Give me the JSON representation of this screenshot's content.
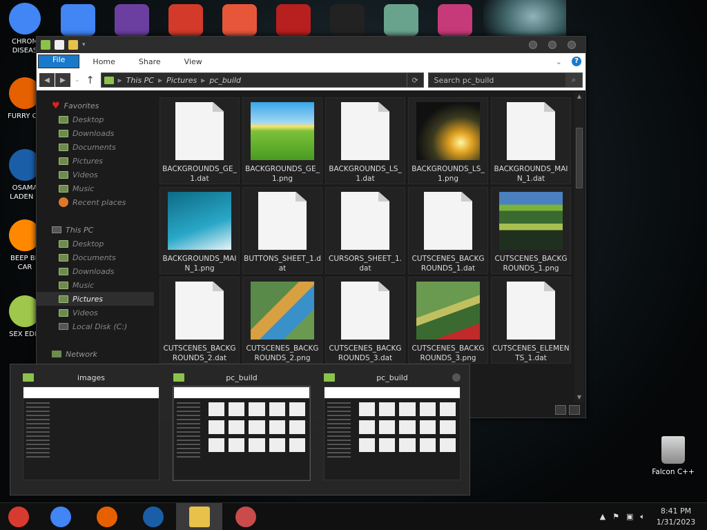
{
  "desktop": {
    "left_icons": [
      {
        "label": "CHROM DISEAS",
        "icon": "chrome-icon",
        "color": "#4285f4"
      },
      {
        "label": "FURRY CU",
        "icon": "firefox-icon",
        "color": "#e66000"
      },
      {
        "label": "OSAMA LADEN E",
        "icon": "obama-logo-icon",
        "color": "#1a5ea8"
      },
      {
        "label": "BEEP BE CAR",
        "icon": "vlc-icon",
        "color": "#ff8800"
      },
      {
        "label": "SEX EDIT",
        "icon": "hex-editor-icon",
        "color": "#9fc74b"
      }
    ],
    "top_icons": [
      {
        "icon": "chrome-icon",
        "color": "#4285f4"
      },
      {
        "icon": "visual-studio-icon",
        "color": "#6b3fa0"
      },
      {
        "icon": "number-2-icon",
        "color": "#d43a2a"
      },
      {
        "icon": "p-badge-icon",
        "color": "#e8563a"
      },
      {
        "icon": "red-logo-icon",
        "color": "#b81f1f"
      },
      {
        "icon": "terminal-icon",
        "color": "#222222"
      },
      {
        "icon": "character-icon",
        "color": "#6aa38d"
      },
      {
        "icon": "film-icon",
        "color": "#c73a7a"
      }
    ],
    "recycle_label": "Falcon C++"
  },
  "explorer": {
    "ribbon_tabs": [
      "File",
      "Home",
      "Share",
      "View"
    ],
    "address": [
      "This PC",
      "Pictures",
      "pc_build"
    ],
    "search_placeholder": "Search pc_build",
    "favorites_header": "Favorites",
    "favorites": [
      "Desktop",
      "Downloads",
      "Documents",
      "Pictures",
      "Videos",
      "Music",
      "Recent places"
    ],
    "thispc_header": "This PC",
    "thispc": [
      "Desktop",
      "Documents",
      "Downloads",
      "Music",
      "Pictures",
      "Videos",
      "Local Disk (C:)"
    ],
    "network_header": "Network",
    "selected_nav": "Pictures",
    "files": [
      {
        "name": "BACKGROUNDS_GE_1.dat",
        "kind": "dat"
      },
      {
        "name": "BACKGROUNDS_GE_1.png",
        "kind": "png",
        "art": "green-hills"
      },
      {
        "name": "BACKGROUNDS_LS_1.dat",
        "kind": "dat"
      },
      {
        "name": "BACKGROUNDS_LS_1.png",
        "kind": "png",
        "art": "light-beam"
      },
      {
        "name": "BACKGROUNDS_MAIN_1.dat",
        "kind": "dat"
      },
      {
        "name": "BACKGROUNDS_MAIN_1.png",
        "kind": "png",
        "art": "blue-sky"
      },
      {
        "name": "BUTTONS_SHEET_1.dat",
        "kind": "dat"
      },
      {
        "name": "CURSORS_SHEET_1.dat",
        "kind": "dat"
      },
      {
        "name": "CUTSCENES_BACKGROUNDS_1.dat",
        "kind": "dat"
      },
      {
        "name": "CUTSCENES_BACKGROUNDS_1.png",
        "kind": "png",
        "art": "cutscene-collage"
      },
      {
        "name": "CUTSCENES_BACKGROUNDS_2.dat",
        "kind": "dat"
      },
      {
        "name": "CUTSCENES_BACKGROUNDS_2.png",
        "kind": "png",
        "art": "scene-tiles"
      },
      {
        "name": "CUTSCENES_BACKGROUNDS_3.dat",
        "kind": "dat"
      },
      {
        "name": "CUTSCENES_BACKGROUNDS_3.png",
        "kind": "png",
        "art": "bird-scene"
      },
      {
        "name": "CUTSCENES_ELEMENTS_1.dat",
        "kind": "dat"
      }
    ]
  },
  "switcher": {
    "windows": [
      {
        "title": "images"
      },
      {
        "title": "pc_build"
      },
      {
        "title": "pc_build"
      }
    ]
  },
  "taskbar": {
    "apps": [
      {
        "icon": "paint-app-icon",
        "color": "#d93a2f"
      },
      {
        "icon": "chrome-icon",
        "color": "#4285f4"
      },
      {
        "icon": "firefox-icon",
        "color": "#e66000"
      },
      {
        "icon": "obama-logo-icon",
        "color": "#1a5ea8"
      },
      {
        "icon": "file-explorer-icon",
        "color": "#e8c14a"
      },
      {
        "icon": "scissors-app-icon",
        "color": "#c94b4b"
      }
    ],
    "time": "8:41 PM",
    "date": "1/31/2023"
  },
  "colors": {
    "accent": "#1979ca",
    "folder": "#8bc34a"
  }
}
